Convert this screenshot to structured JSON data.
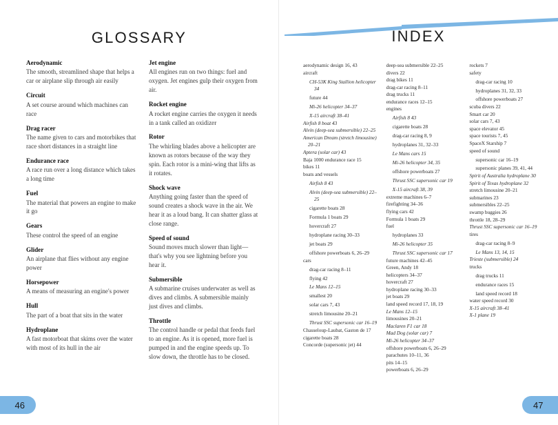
{
  "spread": {
    "left_page": {
      "heading": "GLOSSARY",
      "page_number": "46",
      "columns": [
        {
          "entries": [
            {
              "term": "Aerodynamic",
              "definition": "The smooth, streamlined shape that helps a car or airplane slip through air easily"
            },
            {
              "term": "Circuit",
              "definition": "A set course around which machines can race"
            },
            {
              "term": "Drag racer",
              "definition": "The name given to cars and motorbikes that race short distances in a straight line"
            },
            {
              "term": "Endurance race",
              "definition": "A race run over a long distance which takes a long time"
            },
            {
              "term": "Fuel",
              "definition": "The material that powers an engine to make it go"
            },
            {
              "term": "Gears",
              "definition": "These control the speed of an engine"
            },
            {
              "term": "Glider",
              "definition": "An airplane that flies without any engine power"
            },
            {
              "term": "Horsepower",
              "definition": "A means of measuring an engine's power"
            },
            {
              "term": "Hull",
              "definition": "The part of a boat that sits in the water"
            },
            {
              "term": "Hydroplane",
              "definition": "A fast motorboat that skims over the water with most of its hull in the air"
            }
          ]
        },
        {
          "entries": [
            {
              "term": "Jet engine",
              "definition": "All engines run on two things: fuel and oxygen. Jet engines gulp their oxygen from air."
            },
            {
              "term": "Rocket engine",
              "definition": "A rocket engine carries the oxygen it needs in a tank called an oxidizer"
            },
            {
              "term": "Rotor",
              "definition": "The whirling blades above a helicopter are known as rotors because of the way they spin. Each rotor is a mini-wing that lifts as it rotates."
            },
            {
              "term": "Shock wave",
              "definition": "Anything going faster than the speed of sound creates a shock wave in the air. We hear it as a loud bang. It can shatter glass at close range."
            },
            {
              "term": "Speed of sound",
              "definition": "Sound moves much slower than light—that's why you see lightning before you hear it."
            },
            {
              "term": "Submersible",
              "definition": "A submarine cruises underwater as well as dives and climbs. A submersible mainly just dives and climbs."
            },
            {
              "term": "Throttle",
              "definition": "The control handle or pedal that feeds fuel to an engine. As it is opened, more fuel is pumped in and the engine speeds up. To slow down, the throttle has to be closed."
            }
          ]
        }
      ]
    },
    "right_page": {
      "heading": "INDEX",
      "page_number": "47",
      "accent_color": "#7cb6e4",
      "columns": [
        {
          "entries": [
            {
              "text": "aerodynamic design  16, 43",
              "level": 0,
              "italic": false
            },
            {
              "text": "aircraft",
              "level": 0,
              "italic": false
            },
            {
              "text": "CH-53K King Stallion helicopter  34",
              "level": 1,
              "italic": true
            },
            {
              "text": "future  44",
              "level": 1,
              "italic": false
            },
            {
              "text": "Mi-26 helicopter  34–37",
              "level": 1,
              "italic": true
            },
            {
              "text": "X-15 aircraft  38–41",
              "level": 1,
              "italic": true
            },
            {
              "text": "Airfish 8 boat  43",
              "level": 0,
              "italic": true
            },
            {
              "text": "Alvin (deep-sea submersible)  22–25",
              "level": 0,
              "italic": true
            },
            {
              "text": "American Dream (stretch limousine)  20–21",
              "level": 0,
              "italic": true
            },
            {
              "text": "Aptera (solar car)  43",
              "level": 0,
              "italic": true
            },
            {
              "text": "Baja 1000 endurance race  15",
              "level": 0,
              "italic": false
            },
            {
              "text": "bikes  11",
              "level": 0,
              "italic": false
            },
            {
              "text": "boats and vessels",
              "level": 0,
              "italic": false
            },
            {
              "text": "Airfish 8  43",
              "level": 1,
              "italic": true
            },
            {
              "text": "Alvin (deep-sea submersible)  22–25",
              "level": 1,
              "italic": true
            },
            {
              "text": "cigarette boats  28",
              "level": 1,
              "italic": false
            },
            {
              "text": "Formula 1 boats  29",
              "level": 1,
              "italic": false
            },
            {
              "text": "hovercraft  27",
              "level": 1,
              "italic": false
            },
            {
              "text": "hydroplane racing  30–33",
              "level": 1,
              "italic": false
            },
            {
              "text": "jet boats  29",
              "level": 1,
              "italic": false
            },
            {
              "text": "offshore powerboats  6, 26–29",
              "level": 1,
              "italic": false
            },
            {
              "text": "cars",
              "level": 0,
              "italic": false
            },
            {
              "text": "drag-car racing  8–11",
              "level": 1,
              "italic": false
            },
            {
              "text": "flying  42",
              "level": 1,
              "italic": false
            },
            {
              "text": "Le Mans  12–15",
              "level": 1,
              "italic": true
            },
            {
              "text": "smallest  20",
              "level": 1,
              "italic": false
            },
            {
              "text": "solar cars  7, 43",
              "level": 1,
              "italic": false
            },
            {
              "text": "stretch limousine  20–21",
              "level": 1,
              "italic": false
            },
            {
              "text": "Thrust SSC supersonic car  16–19",
              "level": 1,
              "italic": true
            },
            {
              "text": "Chasseloup-Laubat, Gaston de  17",
              "level": 0,
              "italic": false
            },
            {
              "text": "cigarette boats  28",
              "level": 0,
              "italic": false
            },
            {
              "text": "Concorde (supersonic jet)  44",
              "level": 0,
              "italic": false
            }
          ]
        },
        {
          "entries": [
            {
              "text": "deep-sea submersible  22–25",
              "level": 0,
              "italic": false
            },
            {
              "text": "divers  22",
              "level": 0,
              "italic": false
            },
            {
              "text": "drag bikes  11",
              "level": 0,
              "italic": false
            },
            {
              "text": "drag-car racing  8–11",
              "level": 0,
              "italic": false
            },
            {
              "text": "drag trucks  11",
              "level": 0,
              "italic": false
            },
            {
              "text": "endurance races  12–15",
              "level": 0,
              "italic": false
            },
            {
              "text": "engines",
              "level": 0,
              "italic": false
            },
            {
              "text": "Airfish 8  43",
              "level": 1,
              "italic": true
            },
            {
              "text": "cigarette boats  28",
              "level": 1,
              "italic": false
            },
            {
              "text": "drag-car racing  8, 9",
              "level": 1,
              "italic": false
            },
            {
              "text": "hydroplanes  31, 32–33",
              "level": 1,
              "italic": false
            },
            {
              "text": "Le Mans cars  15",
              "level": 1,
              "italic": true
            },
            {
              "text": "Mi-26 helicopter  34, 35",
              "level": 1,
              "italic": true
            },
            {
              "text": "offshore powerboats  27",
              "level": 1,
              "italic": false
            },
            {
              "text": "Thrust SSC supersonic car  19",
              "level": 1,
              "italic": true
            },
            {
              "text": "X-15 aircraft  38, 39",
              "level": 1,
              "italic": true
            },
            {
              "text": "extreme machines  6–7",
              "level": 0,
              "italic": false
            },
            {
              "text": "firefighting  34–36",
              "level": 0,
              "italic": false
            },
            {
              "text": "flying cars  42",
              "level": 0,
              "italic": false
            },
            {
              "text": "Formula 1 boats  29",
              "level": 0,
              "italic": false
            },
            {
              "text": "fuel",
              "level": 0,
              "italic": false
            },
            {
              "text": "hydroplanes  33",
              "level": 1,
              "italic": false
            },
            {
              "text": "Mi-26 helicopter  35",
              "level": 1,
              "italic": true
            },
            {
              "text": "Thrust SSC supersonic car  17",
              "level": 1,
              "italic": true
            },
            {
              "text": "future machines  42–45",
              "level": 0,
              "italic": false
            },
            {
              "text": "Green, Andy  18",
              "level": 0,
              "italic": false
            },
            {
              "text": "helicopters  34–37",
              "level": 0,
              "italic": false
            },
            {
              "text": "hovercraft  27",
              "level": 0,
              "italic": false
            },
            {
              "text": "hydroplane racing  30–33",
              "level": 0,
              "italic": false
            },
            {
              "text": "jet boats  29",
              "level": 0,
              "italic": false
            },
            {
              "text": "land speed record  17, 18, 19",
              "level": 0,
              "italic": false
            },
            {
              "text": "Le Mans  12–15",
              "level": 0,
              "italic": true
            },
            {
              "text": "limousines  20–21",
              "level": 0,
              "italic": false
            },
            {
              "text": "Maclaren F1 car  18",
              "level": 0,
              "italic": true
            },
            {
              "text": "Mad Dog (solar car)  7",
              "level": 0,
              "italic": true
            },
            {
              "text": "Mi-26 helicopter  34–37",
              "level": 0,
              "italic": true
            },
            {
              "text": "offshore powerboats  6, 26–29",
              "level": 0,
              "italic": false
            },
            {
              "text": "parachutes  10–11, 36",
              "level": 0,
              "italic": false
            },
            {
              "text": "pits  14–15",
              "level": 0,
              "italic": false
            },
            {
              "text": "powerboats  6, 26–29",
              "level": 0,
              "italic": false
            }
          ]
        },
        {
          "entries": [
            {
              "text": "rockets  7",
              "level": 0,
              "italic": false
            },
            {
              "text": "safety",
              "level": 0,
              "italic": false
            },
            {
              "text": "drag-car racing  10",
              "level": 1,
              "italic": false
            },
            {
              "text": "hydroplanes  31, 32, 33",
              "level": 1,
              "italic": false
            },
            {
              "text": "offshore powerboats  27",
              "level": 1,
              "italic": false
            },
            {
              "text": "scuba divers  22",
              "level": 0,
              "italic": false
            },
            {
              "text": "Smart car  20",
              "level": 0,
              "italic": false
            },
            {
              "text": "solar cars  7, 43",
              "level": 0,
              "italic": false
            },
            {
              "text": "space elevator  45",
              "level": 0,
              "italic": false
            },
            {
              "text": "space tourists  7, 45",
              "level": 0,
              "italic": false
            },
            {
              "text": "SpaceX Starship  7",
              "level": 0,
              "italic": false
            },
            {
              "text": "speed of sound",
              "level": 0,
              "italic": false
            },
            {
              "text": "supersonic car  16–19",
              "level": 1,
              "italic": false
            },
            {
              "text": "supersonic planes  39, 41, 44",
              "level": 1,
              "italic": false
            },
            {
              "text": "Spirit of Australia hydroplane  30",
              "level": 0,
              "italic": true
            },
            {
              "text": "Spirit of Texas hydroplane  32",
              "level": 0,
              "italic": true
            },
            {
              "text": "stretch limousine  20–21",
              "level": 0,
              "italic": false
            },
            {
              "text": "submarines  23",
              "level": 0,
              "italic": false
            },
            {
              "text": "submersibles  22–25",
              "level": 0,
              "italic": false
            },
            {
              "text": "swamp buggies  26",
              "level": 0,
              "italic": false
            },
            {
              "text": "throttle  18, 28–29",
              "level": 0,
              "italic": false
            },
            {
              "text": "Thrust SSC supersonic car  16–19",
              "level": 0,
              "italic": true
            },
            {
              "text": "tires",
              "level": 0,
              "italic": false
            },
            {
              "text": "drag-car racing  8–9",
              "level": 1,
              "italic": false
            },
            {
              "text": "Le Mans  13, 14, 15",
              "level": 1,
              "italic": true
            },
            {
              "text": "Trieste (submersible)  24",
              "level": 0,
              "italic": true
            },
            {
              "text": "trucks",
              "level": 0,
              "italic": false
            },
            {
              "text": "drag trucks  11",
              "level": 1,
              "italic": false
            },
            {
              "text": "endurance races  15",
              "level": 1,
              "italic": false
            },
            {
              "text": "land speed record  18",
              "level": 1,
              "italic": false
            },
            {
              "text": "water speed record  30",
              "level": 0,
              "italic": false
            },
            {
              "text": "X-15 aircraft  38–41",
              "level": 0,
              "italic": true
            },
            {
              "text": "X-1 plane  19",
              "level": 0,
              "italic": true
            }
          ]
        }
      ]
    }
  }
}
